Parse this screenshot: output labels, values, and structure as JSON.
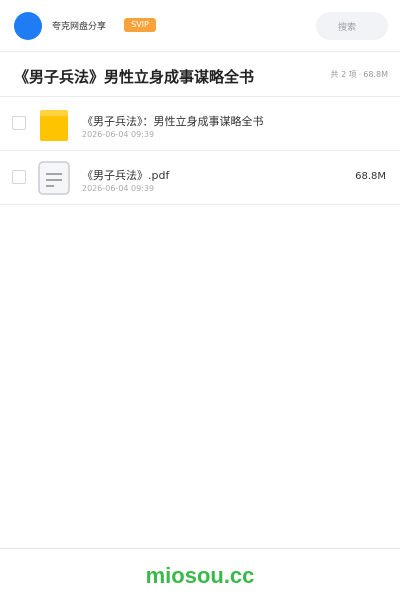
{
  "header": {
    "avatar_icon": "avatar-circle",
    "avatar_color": "#1f7cf5",
    "share_name": "夸克网盘分享",
    "badge": "SVIP",
    "badge_color": "#f7a23b",
    "search_placeholder": "搜索"
  },
  "title_bar": {
    "title": "《男子兵法》男性立身成事谋略全书",
    "item_count": "共 2 项",
    "separator": "·",
    "total_size": "68.8M"
  },
  "files": [
    {
      "icon": "folder-icon",
      "name": "《男子兵法》：男性立身成事谋略全书",
      "date": "2026-06-04 09:39",
      "size": ""
    },
    {
      "icon": "document-icon",
      "name": "《男子兵法》.pdf",
      "date": "2026-06-04 09:39",
      "size": "68.8M"
    }
  ],
  "footer": {
    "brand": "miosou.cc",
    "brand_color": "#3cb84a"
  }
}
